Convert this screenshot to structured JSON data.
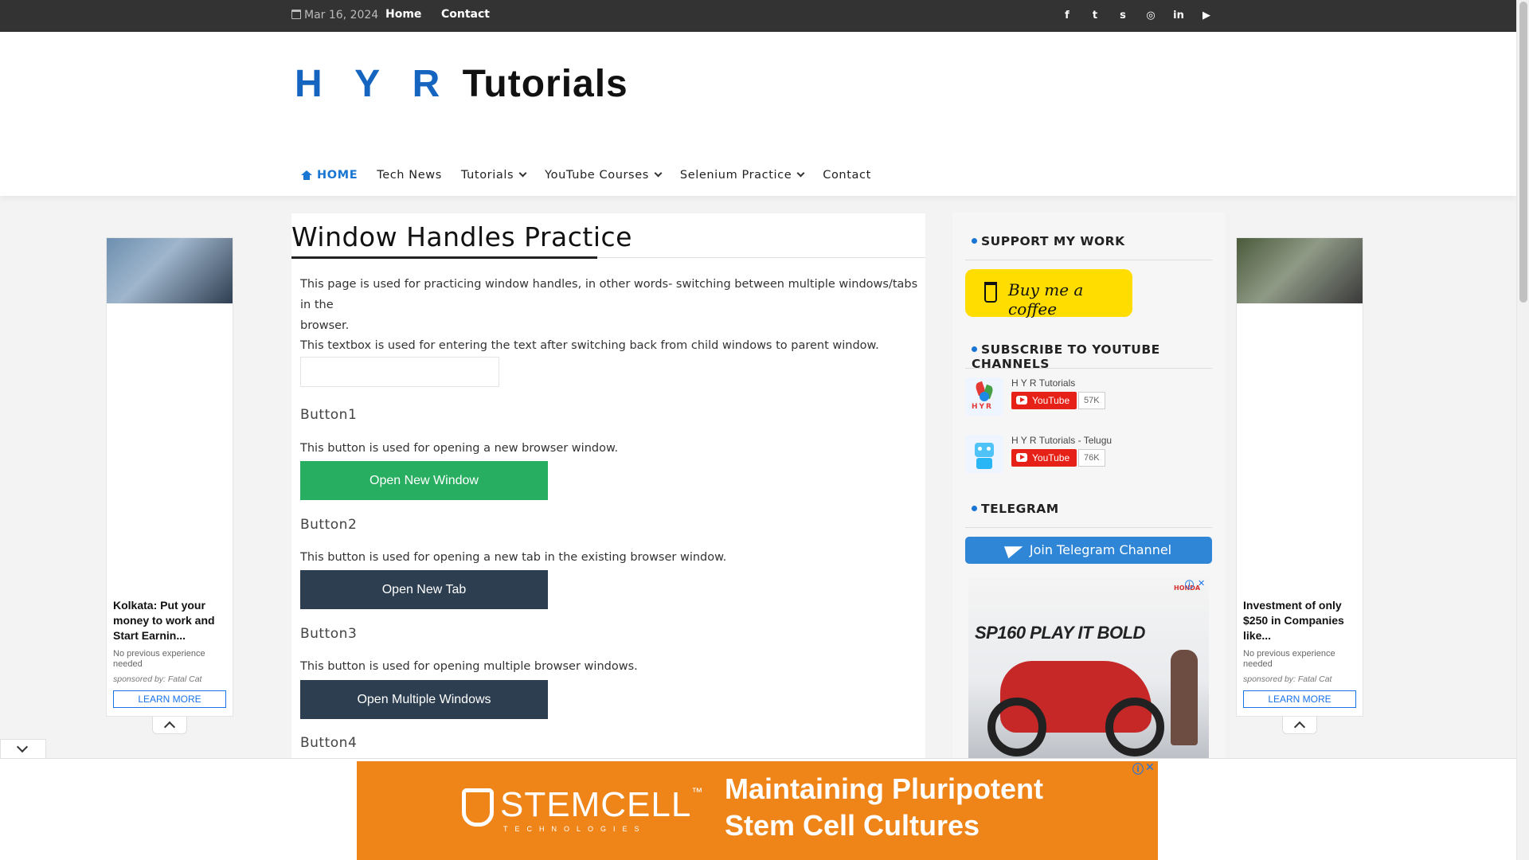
{
  "topbar": {
    "date": "Mar 16, 2024",
    "links": [
      "Home",
      "Contact"
    ],
    "social_icons": [
      "facebook-icon",
      "twitter-icon",
      "skype-icon",
      "instagram-icon",
      "linkedin-icon",
      "youtube-icon"
    ],
    "social_glyphs": [
      "f",
      "t",
      "s",
      "◎",
      "in",
      "▶"
    ]
  },
  "logo": {
    "part1": "H Y R",
    "part2": "Tutorials"
  },
  "nav": {
    "items": [
      {
        "label": "HOME",
        "active": true,
        "dropdown": false
      },
      {
        "label": "Tech News",
        "active": false,
        "dropdown": false
      },
      {
        "label": "Tutorials",
        "active": false,
        "dropdown": true
      },
      {
        "label": "YouTube Courses",
        "active": false,
        "dropdown": true
      },
      {
        "label": "Selenium Practice",
        "active": false,
        "dropdown": true
      },
      {
        "label": "Contact",
        "active": false,
        "dropdown": false
      }
    ]
  },
  "main": {
    "title": "Window Handles Practice",
    "intro_line1": "This page is used for practicing window handles, in other words- switching between multiple windows/tabs in the",
    "intro_line2": "browser.",
    "textbox_desc": "This textbox is used for entering the text after switching back from child windows to parent window.",
    "textbox_value": "",
    "buttons": [
      {
        "heading": "Button1",
        "desc": "This button is used for opening a new browser window.",
        "label": "Open New Window"
      },
      {
        "heading": "Button2",
        "desc": "This button is used for opening a new tab in the existing browser window.",
        "label": "Open New Tab"
      },
      {
        "heading": "Button3",
        "desc": "This button is used for opening multiple browser windows.",
        "label": "Open Multiple Windows"
      },
      {
        "heading": "Button4",
        "desc": "",
        "label": ""
      }
    ]
  },
  "sidebar": {
    "support_title": "SUPPORT MY WORK",
    "coffee_label": "Buy me a coffee",
    "subscribe_title": "SUBSCRIBE TO YOUTUBE CHANNELS",
    "channels": [
      {
        "name": "H Y R Tutorials",
        "button": "YouTube",
        "count": "57K",
        "avatar_label": "HYR"
      },
      {
        "name": "H Y R Tutorials - Telugu",
        "button": "YouTube",
        "count": "76K"
      }
    ],
    "telegram_title": "TELEGRAM",
    "telegram_button": "Join Telegram Channel",
    "ad": {
      "headline": "SP160 PLAY IT BOLD",
      "brand": "HONDA"
    }
  },
  "left_ad": {
    "headline": "Kolkata: Put your money to work and Start Earnin...",
    "sub": "No previous experience needed",
    "sponsor": "sponsored by: Fatal Cat",
    "cta": "LEARN MORE"
  },
  "right_ad": {
    "headline": "Investment of only $250 in Companies like...",
    "sub": "No previous experience needed",
    "sponsor": "sponsored by: Fatal Cat",
    "cta": "LEARN MORE"
  },
  "bottom_ad": {
    "brand": "STEMCELL",
    "brand_tm": "™",
    "brand_sub": "TECHNOLOGIES",
    "headline1": "Maintaining Pluripotent",
    "headline2": "Stem Cell Cultures"
  },
  "colors": {
    "accent": "#1976d2",
    "green_button": "#27ae60",
    "navy_button": "#2c3e50",
    "topbar": "#333333",
    "ad_orange": "#ef8418"
  }
}
